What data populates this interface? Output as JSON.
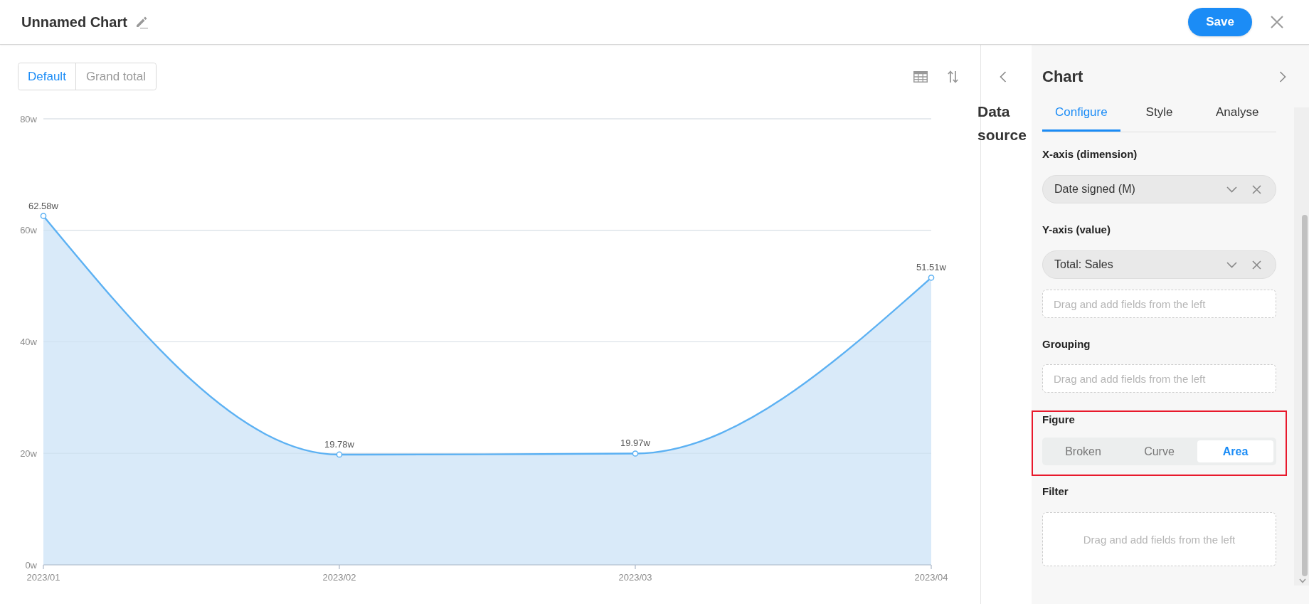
{
  "header": {
    "title": "Unnamed Chart",
    "save_label": "Save"
  },
  "view_toggle": [
    {
      "label": "Default",
      "selected": true
    },
    {
      "label": "Grand total",
      "selected": false
    }
  ],
  "chart": {
    "chart_data": {
      "type": "area",
      "categories": [
        "2023/01",
        "2023/02",
        "2023/03",
        "2023/04"
      ],
      "values": [
        62.58,
        19.78,
        19.97,
        51.51
      ],
      "ylim": [
        0,
        80
      ],
      "yticks": [
        {
          "value": 0,
          "label": "0w"
        },
        {
          "value": 20,
          "label": "20w"
        },
        {
          "value": 40,
          "label": "40w"
        },
        {
          "value": 60,
          "label": "60w"
        },
        {
          "value": 80,
          "label": "80w"
        }
      ],
      "grid": true,
      "value_labels": [
        "62.58w",
        "19.78w",
        "19.97w",
        "51.51w"
      ]
    }
  },
  "data_source_panel": {
    "title": "Data source"
  },
  "config_panel": {
    "title": "Chart",
    "tabs": [
      {
        "label": "Configure",
        "selected": true
      },
      {
        "label": "Style",
        "selected": false
      },
      {
        "label": "Analyse",
        "selected": false
      }
    ],
    "sections": [
      {
        "kind": "fields",
        "label": "X-axis (dimension)",
        "highlighted": false,
        "items": [
          {
            "kind": "chip",
            "text": "Date signed (M)"
          }
        ]
      },
      {
        "kind": "fields",
        "label": "Y-axis (value)",
        "highlighted": false,
        "items": [
          {
            "kind": "chip",
            "text": "Total: Sales"
          },
          {
            "kind": "drop",
            "text": "Drag and add fields from the left"
          }
        ]
      },
      {
        "kind": "fields",
        "label": "Grouping",
        "highlighted": false,
        "items": [
          {
            "kind": "drop",
            "text": "Drag and add fields from the left"
          }
        ]
      },
      {
        "kind": "segmented",
        "label": "Figure",
        "highlighted": true,
        "options": [
          {
            "label": "Broken",
            "selected": false
          },
          {
            "label": "Curve",
            "selected": false
          },
          {
            "label": "Area",
            "selected": true
          }
        ]
      },
      {
        "kind": "fields",
        "label": "Filter",
        "highlighted": false,
        "items": [
          {
            "kind": "drop_large",
            "text": "Drag and add fields from the left"
          }
        ]
      }
    ]
  }
}
